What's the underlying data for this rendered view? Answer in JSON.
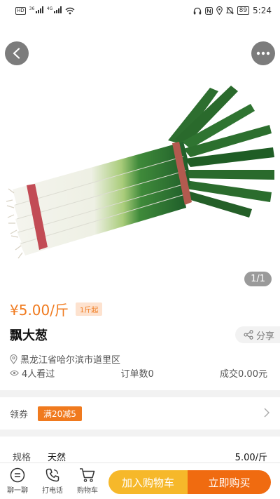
{
  "status_bar": {
    "left_badges": [
      "HD",
      "36",
      "4G"
    ],
    "battery": "89",
    "time": "5:24",
    "icons": [
      "headphones-icon",
      "nfc-icon",
      "location-icon",
      "mute-icon",
      "battery-icon"
    ]
  },
  "hero": {
    "counter": "1/1",
    "back_icon": "chevron-left-icon",
    "more_icon": "more-dots-icon"
  },
  "product": {
    "price": "¥5.00/斤",
    "min_order": "1斤起",
    "title": "飘大葱",
    "share_label": "分享",
    "location": "黑龙江省哈尔滨市道里区",
    "views": "4人看过",
    "orders": "订单数0",
    "turnover": "成交0.00元"
  },
  "coupon": {
    "label": "领券",
    "tag": "满20减5"
  },
  "spec": {
    "label": "规格",
    "value": "天然",
    "price": "5.00/斤"
  },
  "bottom_bar": {
    "chat_label": "聊一聊",
    "call_label": "打电话",
    "cart_label": "购物车",
    "add_to_cart": "加入购物车",
    "buy_now": "立即购买"
  },
  "colors": {
    "accent_orange": "#f07a1e",
    "cart_yellow": "#f6b82a",
    "buy_orange": "#f06b10"
  }
}
